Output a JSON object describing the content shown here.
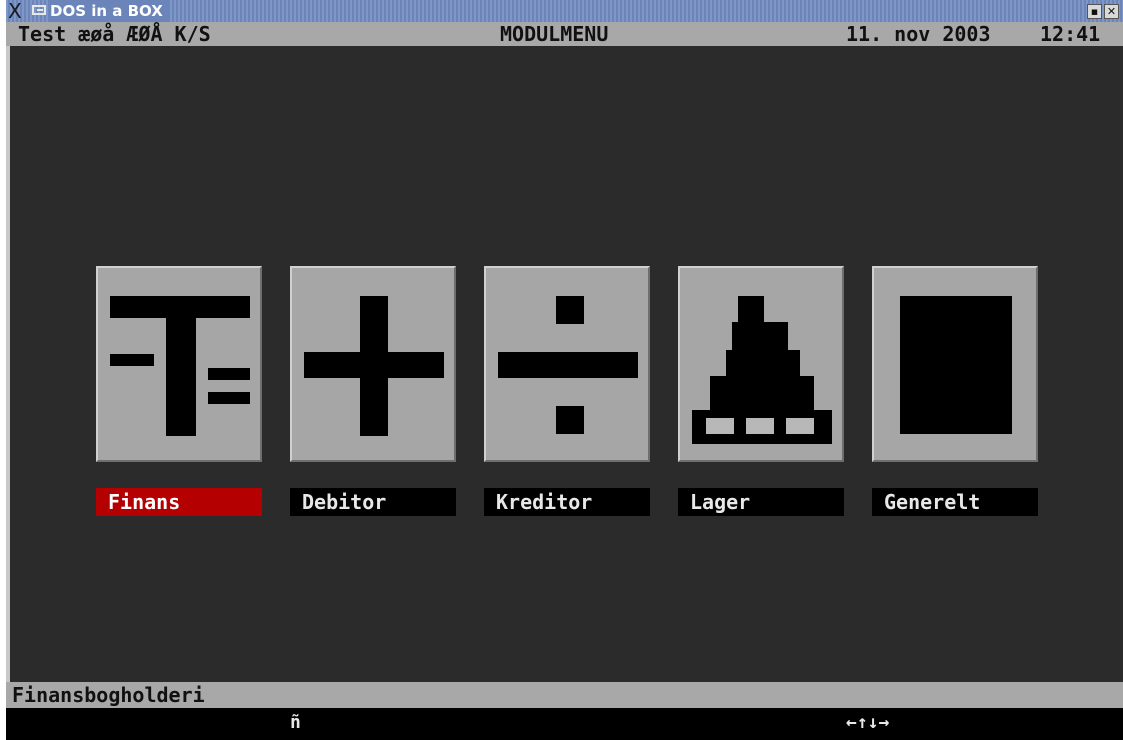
{
  "window": {
    "title": "DOS in a BOX",
    "minimize_symbol": "▪",
    "close_symbol": "✕"
  },
  "header": {
    "company": "Test æøå ÆØÅ K/S",
    "screen_title": "MODULMENU",
    "date": "11. nov 2003",
    "time": "12:41"
  },
  "modules": [
    {
      "label": "Finans",
      "icon": "t-account-icon",
      "selected": true
    },
    {
      "label": "Debitor",
      "icon": "plus-icon",
      "selected": false
    },
    {
      "label": "Kreditor",
      "icon": "divide-icon",
      "selected": false
    },
    {
      "label": "Lager",
      "icon": "stock-pile-icon",
      "selected": false
    },
    {
      "label": "Generelt",
      "icon": "black-square-icon",
      "selected": false
    }
  ],
  "status": {
    "description": "Finansbogholderi"
  },
  "keybar": {
    "help_key": "ñ",
    "arrows": "←↑↓→"
  },
  "colors": {
    "desktop": "#2b2b2b",
    "bar_gray": "#a8a8a8",
    "tile_gray": "#a6a6a6",
    "selected_red": "#b40000",
    "titlebar_blue": "#6b85bb"
  }
}
